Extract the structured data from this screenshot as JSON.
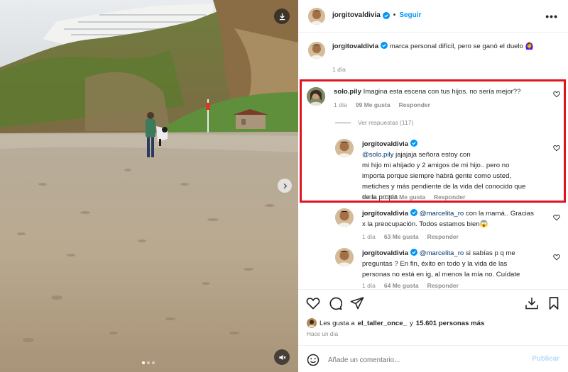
{
  "post": {
    "author": "jorgitovaldivia",
    "follow_label": "Seguir",
    "more_label": "•••",
    "caption_author": "jorgitovaldivia",
    "caption_text": "marca personal difícil, pero se ganó el duelo 🙆‍♀️",
    "caption_time": "1 día"
  },
  "comments": [
    {
      "author": "solo.pily",
      "text": "Imagina esta escena con tus hijos. no sería mejor??",
      "time": "1 día",
      "likes": "99 Me gusta",
      "reply": "Responder",
      "view_replies": "Ver respuestas (117)"
    },
    {
      "author": "jorgitovaldivia",
      "mention": "@solo.pily",
      "text_lines": [
        " jajajaja señora estoy con",
        "mi hijo mi ahijado y 2 amigos de mi hijo.. pero no",
        "importa porque siempre habrá gente como usted,",
        "metiches y más pendiente de la vida del conocido que",
        "de la propia"
      ],
      "time": "1 día",
      "likes": "1006 Me gusta",
      "reply": "Responder"
    },
    {
      "author": "jorgitovaldivia",
      "mention": "@marcelita_ro",
      "text_lines": [
        " con la mamá.. Gracias",
        "x la preocupación. Todos estamos bien😱"
      ],
      "time": "1 día",
      "likes": "63 Me gusta",
      "reply": "Responder"
    },
    {
      "author": "jorgitovaldivia",
      "mention": "@marcelita_ro",
      "text_lines": [
        " si sabías p q me",
        "preguntas ? En fin, éxito en todo y la vida de las",
        "personas no está en ig, al menos la mía no. Cuídate"
      ],
      "time": "1 día",
      "likes": "64 Me gusta",
      "reply": "Responder"
    }
  ],
  "footer": {
    "likes_prefix": "Les gusta a",
    "likes_user": "el_taller_once_",
    "likes_connector": "y",
    "likes_count": "15.601 personas más",
    "time_ago": "Hace un día",
    "comment_placeholder": "Añade un comentario...",
    "publish_label": "Publicar"
  },
  "media": {
    "carousel_total": 3,
    "carousel_active": 1
  },
  "colors": {
    "accent": "#0095f6",
    "highlight_border": "#e0141e",
    "verified": "#0095f6",
    "muted_text": "#8e8e8e"
  }
}
